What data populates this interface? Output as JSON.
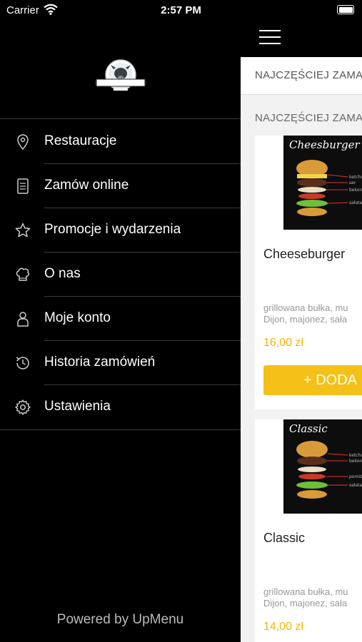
{
  "status": {
    "carrier": "Carrier",
    "time": "2:57 PM"
  },
  "drawer": {
    "logo_icon": "restaurant-logo",
    "items": [
      {
        "label": "Restauracje",
        "icon": "location-pin-icon"
      },
      {
        "label": "Zamów online",
        "icon": "document-icon"
      },
      {
        "label": "Promocje i wydarzenia",
        "icon": "star-icon"
      },
      {
        "label": "O nas",
        "icon": "chef-hat-icon"
      },
      {
        "label": "Moje konto",
        "icon": "user-icon"
      },
      {
        "label": "Historia zamówień",
        "icon": "history-icon"
      },
      {
        "label": "Ustawienia",
        "icon": "gear-icon"
      }
    ],
    "powered_by": "Powered by UpMenu"
  },
  "content": {
    "tab_label": "NAJCZĘŚCIEJ ZAMA",
    "section_title": "NAJCZĘŚCIEJ ZAMA",
    "products": [
      {
        "image_label": "Cheesburger",
        "name": "Cheeseburger",
        "desc1": "grillowana bułka, mu",
        "desc2": "Dijon, majonez, sała",
        "price": "16,00 zł",
        "add_label": "+ DODA"
      },
      {
        "image_label": "Classic",
        "name": "Classic",
        "desc1": "grillowana bułka, mu",
        "desc2": "Dijon, majonez, sała",
        "price": "14,00 zł"
      }
    ]
  },
  "colors": {
    "accent": "#f5c018",
    "price": "#f2b705",
    "drawer_bg": "#000000"
  }
}
